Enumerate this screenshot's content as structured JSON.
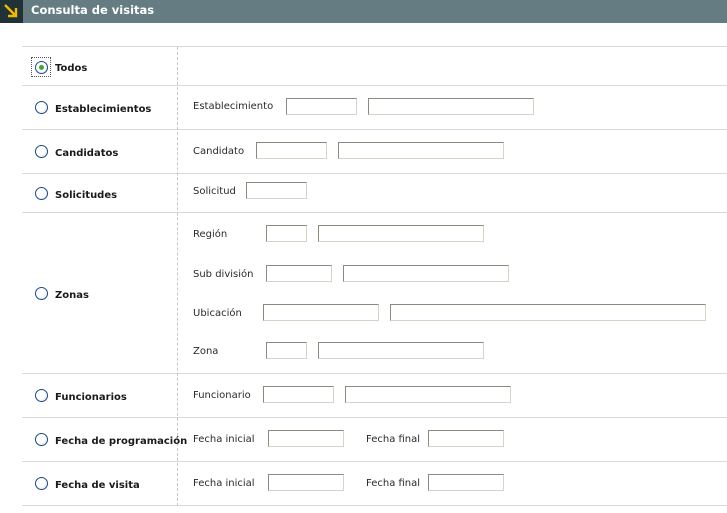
{
  "header": {
    "title": "Consulta de visitas",
    "icon": "arrow-down-right-icon",
    "accent": "#f2b900"
  },
  "options": {
    "todos": "Todos",
    "establecimientos": "Establecimientos",
    "candidatos": "Candidatos",
    "solicitudes": "Solicitudes",
    "zonas": "Zonas",
    "funcionarios": "Funcionarios",
    "fecha_programacion": "Fecha de programación",
    "fecha_visita": "Fecha de visita"
  },
  "fields": {
    "establecimiento": "Establecimiento",
    "candidato": "Candidato",
    "solicitud": "Solicitud",
    "region": "Región",
    "sub_division": "Sub división",
    "ubicacion": "Ubicación",
    "zona": "Zona",
    "funcionario": "Funcionario",
    "fecha_inicial": "Fecha inicial",
    "fecha_final": "Fecha final"
  },
  "selected_option": "todos"
}
